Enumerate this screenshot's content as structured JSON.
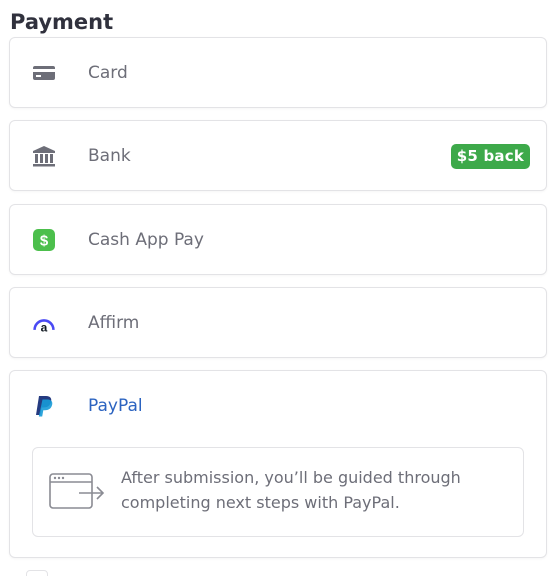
{
  "payment": {
    "title": "Payment",
    "methods": [
      {
        "label": "Card",
        "icon": "card-icon"
      },
      {
        "label": "Bank",
        "icon": "bank-icon",
        "badge": "$5 back"
      },
      {
        "label": "Cash App Pay",
        "icon": "cash-app-icon"
      },
      {
        "label": "Affirm",
        "icon": "affirm-icon"
      },
      {
        "label": "PayPal",
        "icon": "paypal-icon",
        "selected": true
      }
    ],
    "paypal_info": "After submission, you’ll be guided through completing next steps with PayPal."
  },
  "colors": {
    "selected_label": "#2b63c0",
    "badge_bg": "#3da94a",
    "cash_app_green": "#4cbf4c",
    "affirm_blue": "#4a4af4",
    "paypal_dark": "#253b80",
    "paypal_light": "#179bd7"
  }
}
